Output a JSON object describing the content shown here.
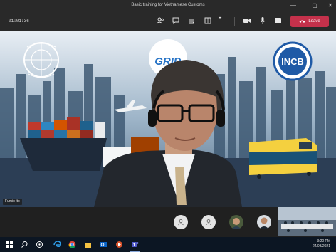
{
  "window": {
    "title": "Basic training for Vietnamese Customs",
    "minimize_glyph": "—",
    "restore_glyph": "▢",
    "close_glyph": "✕"
  },
  "toolbar": {
    "timer": "01:01:36",
    "leave_label": "Leave",
    "more_glyph": "•••",
    "icons": [
      "participants-icon",
      "chat-icon",
      "raise-hand-icon",
      "rooms-icon",
      "more-actions-icon",
      "camera-icon",
      "mic-icon",
      "share-screen-icon",
      "phone-hangup-icon"
    ]
  },
  "stage": {
    "speaker_name": "Fumio Ito",
    "logos": [
      "GRID",
      "INCB"
    ]
  },
  "participants": {
    "items": [
      {
        "type": "avatar-generic"
      },
      {
        "type": "avatar-generic"
      },
      {
        "type": "avatar-photo"
      },
      {
        "type": "avatar-photo"
      }
    ]
  },
  "taskbar": {
    "time": "3:20 PM",
    "date": "24/03/2021"
  },
  "colors": {
    "leave": "#c4314b",
    "titlebar": "#292929",
    "taskbar": "#0c1623"
  }
}
